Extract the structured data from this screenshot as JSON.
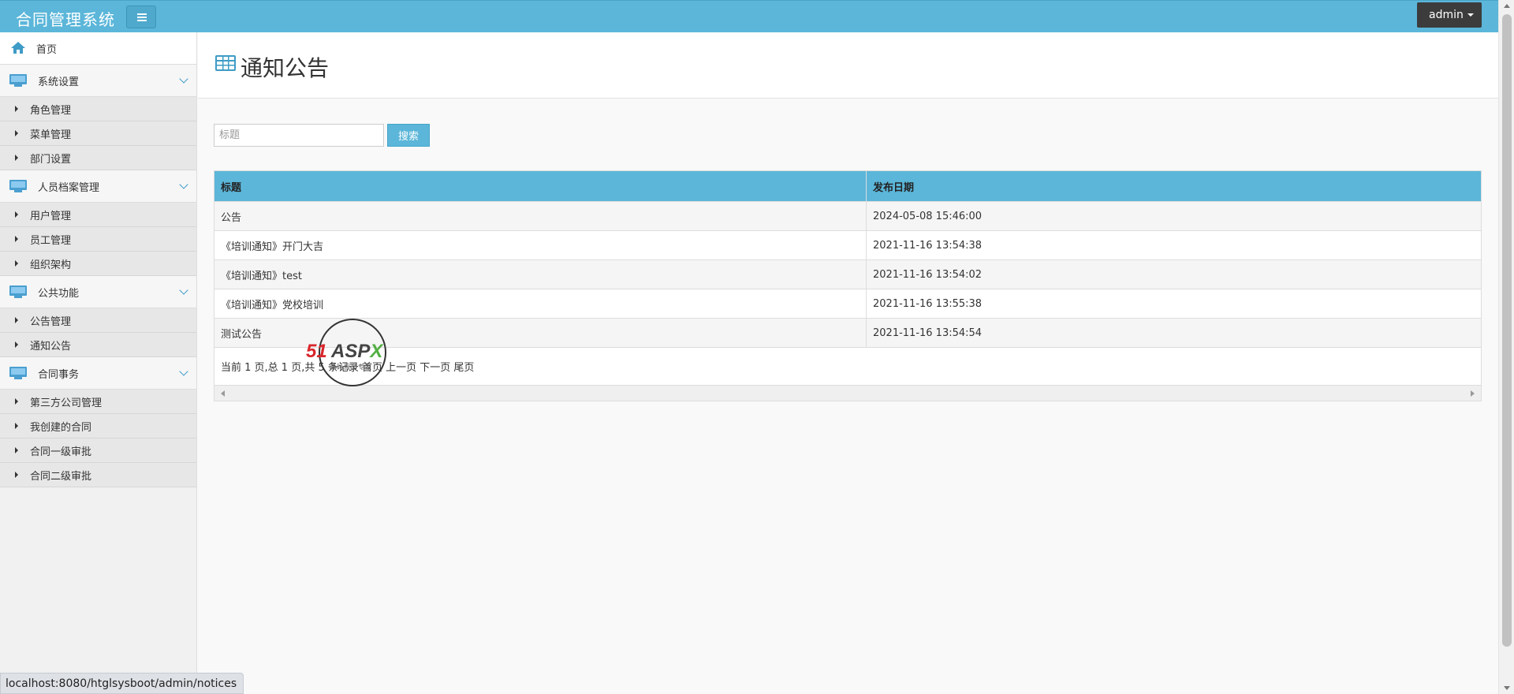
{
  "app": {
    "title": "合同管理系统",
    "user_label": "admin"
  },
  "colors": {
    "accent": "#5bb6d9",
    "sidebar_bg": "#f1f1f1",
    "icon": "#3e9cc6"
  },
  "sidebar": {
    "home": {
      "label": "首页",
      "icon": "home-icon"
    },
    "groups": [
      {
        "label": "系统设置",
        "icon": "monitor-icon",
        "items": [
          "角色管理",
          "菜单管理",
          "部门设置"
        ]
      },
      {
        "label": "人员档案管理",
        "icon": "monitor-icon",
        "items": [
          "用户管理",
          "员工管理",
          "组织架构"
        ]
      },
      {
        "label": "公共功能",
        "icon": "monitor-icon",
        "items": [
          "公告管理",
          "通知公告"
        ]
      },
      {
        "label": "合同事务",
        "icon": "monitor-icon",
        "items": [
          "第三方公司管理",
          "我创建的合同",
          "合同一级审批",
          "合同二级审批"
        ]
      }
    ]
  },
  "page": {
    "title": "通知公告",
    "icon": "table-icon"
  },
  "search": {
    "placeholder": "标题",
    "value": "",
    "button_label": "搜索"
  },
  "table": {
    "columns": [
      "标题",
      "发布日期"
    ],
    "rows": [
      [
        "公告",
        "2024-05-08 15:46:00"
      ],
      [
        "《培训通知》开门大吉",
        "2021-11-16 13:54:38"
      ],
      [
        "《培训通知》test",
        "2021-11-16 13:54:02"
      ],
      [
        "《培训通知》党校培训",
        "2021-11-16 13:55:38"
      ],
      [
        "测试公告",
        "2021-11-16 13:54:54"
      ]
    ],
    "pager_text": "当前 1 页,总 1 页,共 5 条记录 首页 上一页 下一页 尾页"
  },
  "watermark": {
    "brand_number": "51",
    "brand_name": "ASP",
    "brand_x": "X",
    "tagline": "源码服务专家"
  },
  "status_bar": {
    "url": "localhost:8080/htglsysboot/admin/notices"
  }
}
